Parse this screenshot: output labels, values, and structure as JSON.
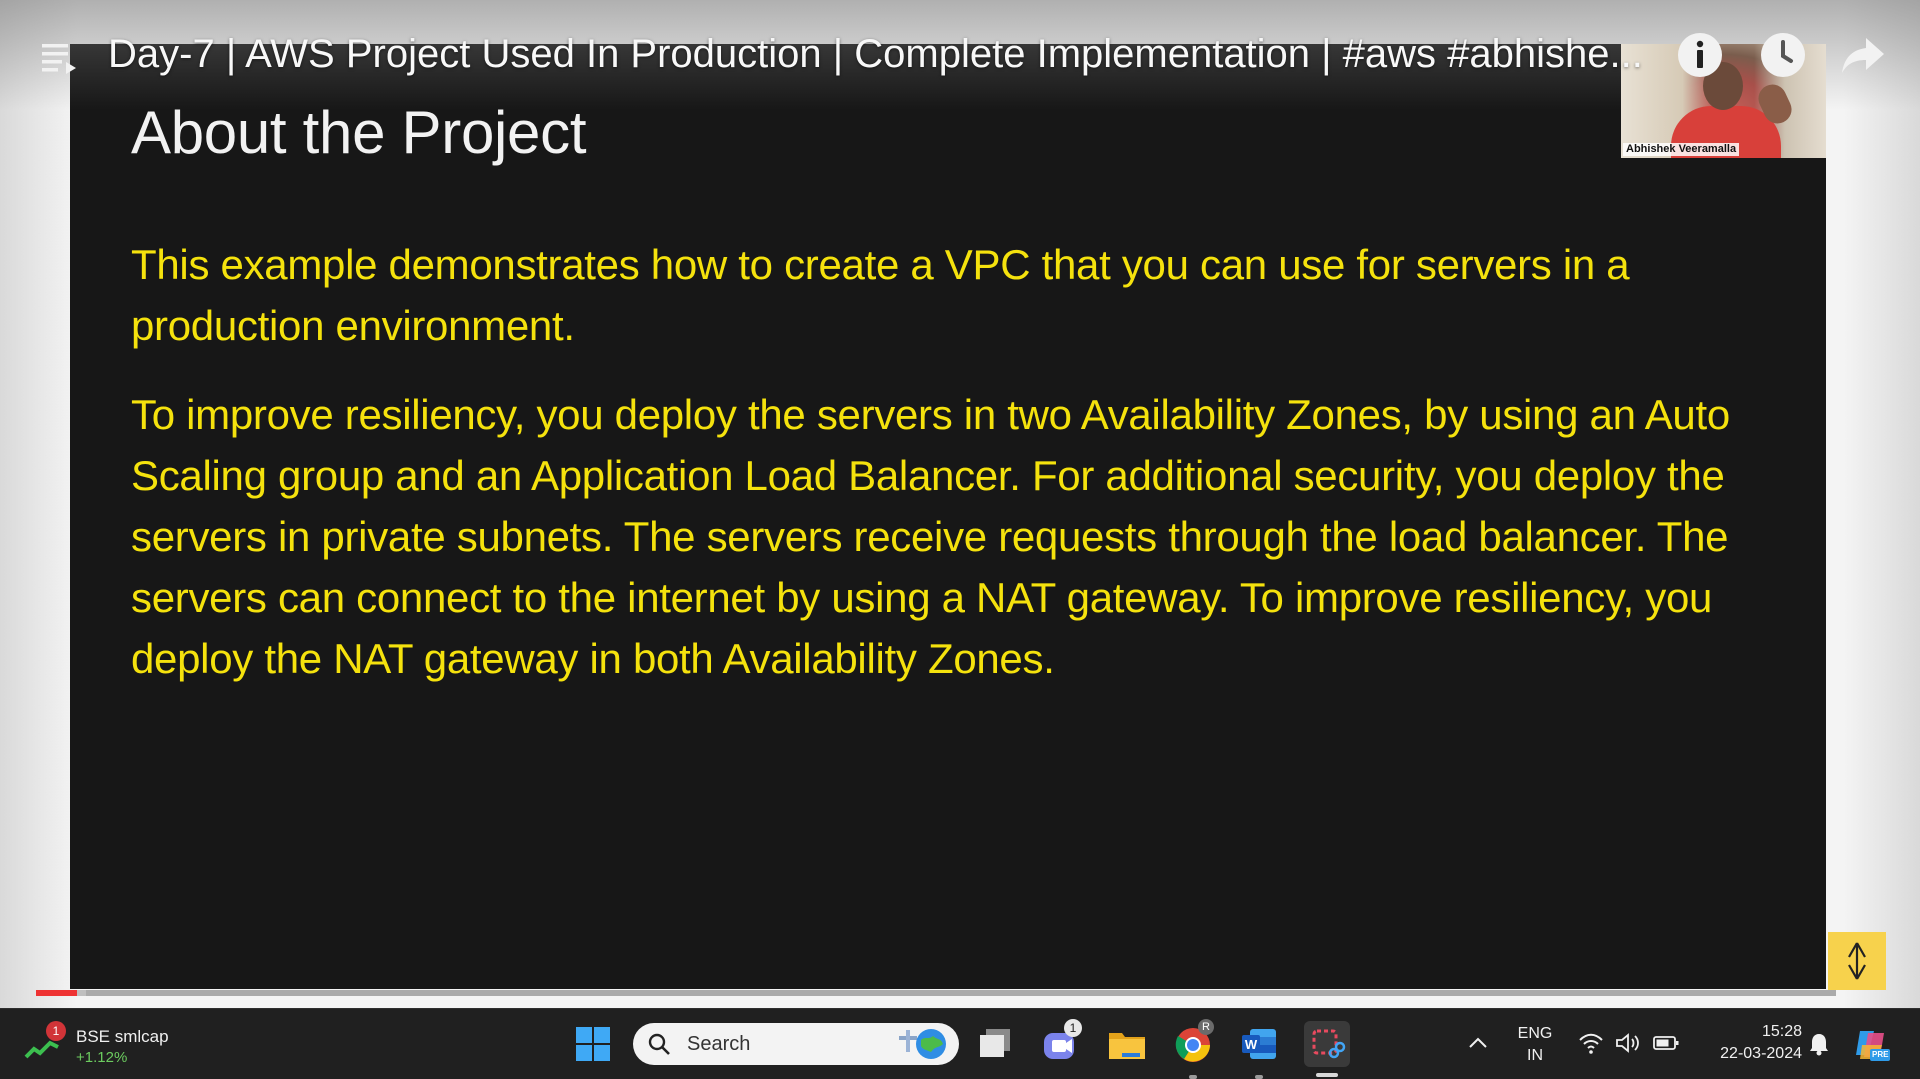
{
  "player": {
    "video_title": "Day-7 | AWS Project Used In Production | Complete Implementation | #aws #abhishe...",
    "progress_percent": 2.3,
    "buffered_percent": 2.8
  },
  "webcam": {
    "presenter_name": "Abhishek Veeramalla"
  },
  "slide": {
    "title": "About the Project",
    "paragraphs": [
      "This example demonstrates how to create a VPC that you can use for servers in a production environment.",
      "To improve resiliency, you deploy the servers in two Availability Zones, by using an Auto Scaling group and an Application Load Balancer. For additional security, you deploy the servers in private subnets. The servers receive requests through the load balancer. The servers can connect to the internet by using a NAT gateway. To improve resiliency, you deploy the NAT gateway in both Availability Zones."
    ],
    "text_color": "#f5e20d",
    "background": "#171717"
  },
  "taskbar": {
    "stock": {
      "badge": "1",
      "name": "BSE smlcap",
      "change": "+1.12%"
    },
    "search": {
      "placeholder": "Search"
    },
    "teams_badge": "1",
    "chrome_profile_letter": "R",
    "language": {
      "line1": "ENG",
      "line2": "IN"
    },
    "clock": {
      "time": "15:28",
      "date": "22-03-2024"
    },
    "copilot_badge": "PRE"
  },
  "icons": [
    "menu-icon",
    "info-icon",
    "watch-later-icon",
    "share-icon",
    "windows-start-icon",
    "search-icon",
    "globe-icon",
    "task-view-icon",
    "teams-icon",
    "file-explorer-icon",
    "chrome-icon",
    "word-icon",
    "snipping-tool-icon",
    "chevron-up-icon",
    "wifi-icon",
    "volume-icon",
    "battery-icon",
    "bell-icon",
    "copilot-icon"
  ]
}
